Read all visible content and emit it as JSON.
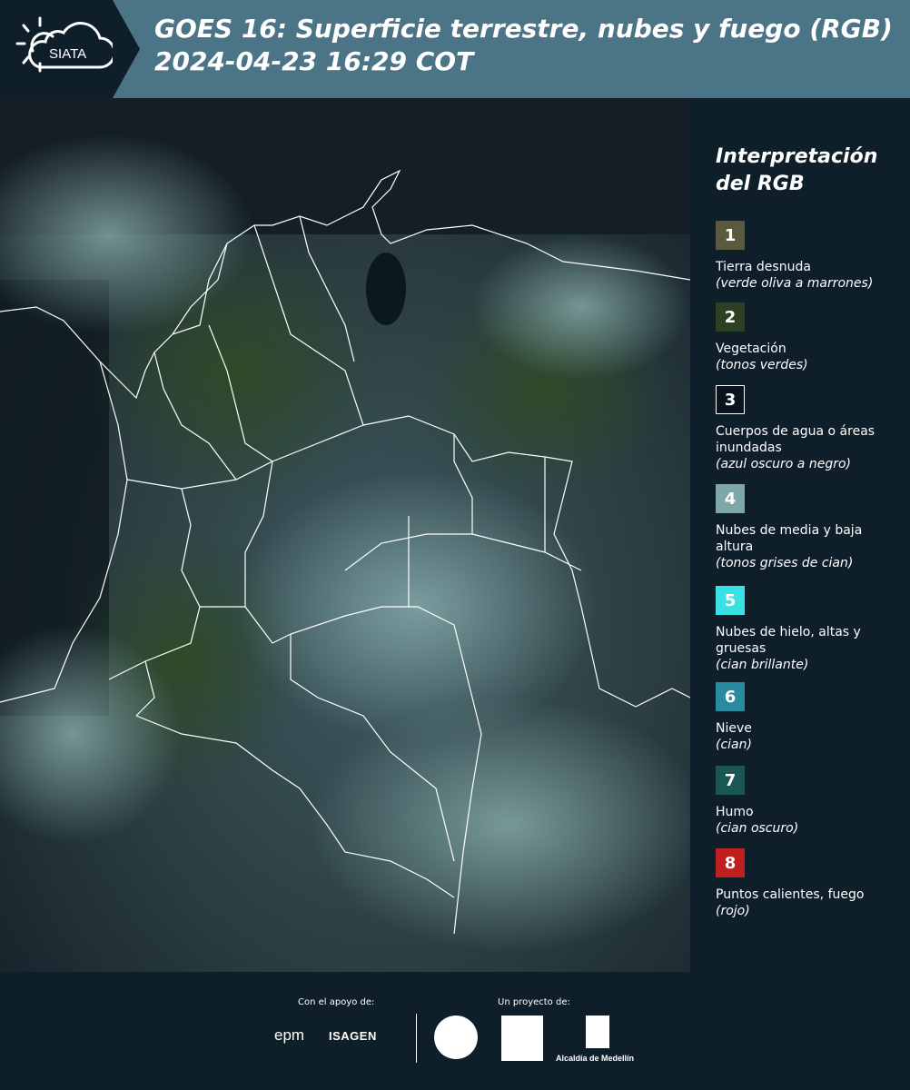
{
  "header": {
    "logo_text": "SIATA",
    "title": "GOES 16: Superficie terrestre, nubes y fuego (RGB)\n 2024-04-23 16:29 COT"
  },
  "legend": {
    "title": "Interpretación\ndel RGB",
    "items": [
      {
        "number": "1",
        "label": "Tierra desnuda",
        "desc": "(verde oliva a marrones)",
        "color": "#5c5a3e"
      },
      {
        "number": "2",
        "label": "Vegetación",
        "desc": "(tonos verdes)",
        "color": "#2e4022"
      },
      {
        "number": "3",
        "label": "Cuerpos de agua o áreas inundadas",
        "desc": "(azul oscuro a negro)",
        "color": "#0a141c"
      },
      {
        "number": "4",
        "label": "Nubes de media y baja altura",
        "desc": "(tonos grises de cian)",
        "color": "#7ea8a8"
      },
      {
        "number": "5",
        "label": "Nubes de hielo, altas y gruesas",
        "desc": "(cian brillante)",
        "color": "#38e2e2"
      },
      {
        "number": "6",
        "label": "Nieve",
        "desc": "(cian)",
        "color": "#2a8aa0"
      },
      {
        "number": "7",
        "label": "Humo",
        "desc": "(cian oscuro)",
        "color": "#1a5654"
      },
      {
        "number": "8",
        "label": "Puntos calientes, fuego",
        "desc": "(rojo)",
        "color": "#c01f1f"
      }
    ]
  },
  "footer": {
    "support_label": "Con el apoyo de:",
    "project_label": "Un proyecto de:",
    "epm": "epm",
    "isagen": "ISAGEN",
    "alcaldia": "Alcaldía de Medellín"
  }
}
